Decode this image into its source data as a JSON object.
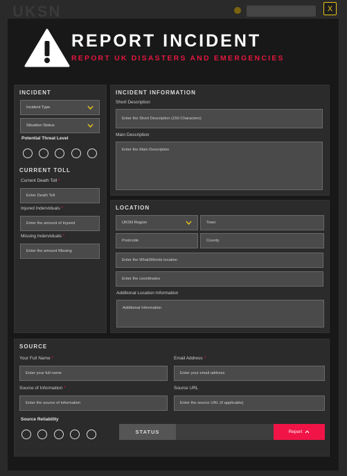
{
  "background": {
    "logo": "UKSN"
  },
  "close_label": "X",
  "header": {
    "title": "REPORT INCIDENT",
    "subtitle": "REPORT UK DISASTERS AND EMERGENCIES",
    "icon": "warning-triangle-icon"
  },
  "incident": {
    "heading": "INCIDENT",
    "type_select": "Incident Type",
    "status_select": "Situation Status",
    "threat_label": "Potential Threat Level",
    "threat_options": 5
  },
  "current_toll": {
    "heading": "CURRENT TOLL",
    "death_label": "Current Death Toll",
    "death_placeholder": "Enter Death Toll",
    "injured_label": "Injured Inderviduals",
    "injured_placeholder": "Enter the amount of Injured",
    "missing_label": "Missing Inderviduals",
    "missing_placeholder": "Enter the amount Missing"
  },
  "incident_information": {
    "heading": "INCIDENT INFORMATION",
    "short_label": "Short Description",
    "short_placeholder": "Enter the Short Description (150 Characters)",
    "main_label": "Main Description",
    "main_placeholder": "Enter the Main Description"
  },
  "location": {
    "heading": "LOCATION",
    "region_select": "UKSN Region",
    "town_placeholder": "Town",
    "postcode_placeholder": "Postcode",
    "county_placeholder": "County",
    "w3w_placeholder": "Enter the What3Words location",
    "coords_placeholder": "Enter the coordinates",
    "additional_label": "Additional Location Information",
    "additional_placeholder": "Additional Information"
  },
  "source": {
    "heading": "SOURCE",
    "name_label": "Your Full Name",
    "name_placeholder": "Enter your full name",
    "email_label": "Email Address",
    "email_placeholder": "Enter your email address",
    "info_label": "Source of Information",
    "info_placeholder": "Enter the source of information",
    "url_label": "Source URL",
    "url_placeholder": "Enter the source URL (if applicable)",
    "reliability_label": "Source Reliability",
    "reliability_options": 5
  },
  "footer": {
    "status_label": "STATUS",
    "report_label": "Report",
    "report_icon": "chevron-up-icon"
  },
  "required_mark": "*",
  "colors": {
    "accent": "#e3173e",
    "button": "#f01546",
    "close": "#e8c51b"
  }
}
